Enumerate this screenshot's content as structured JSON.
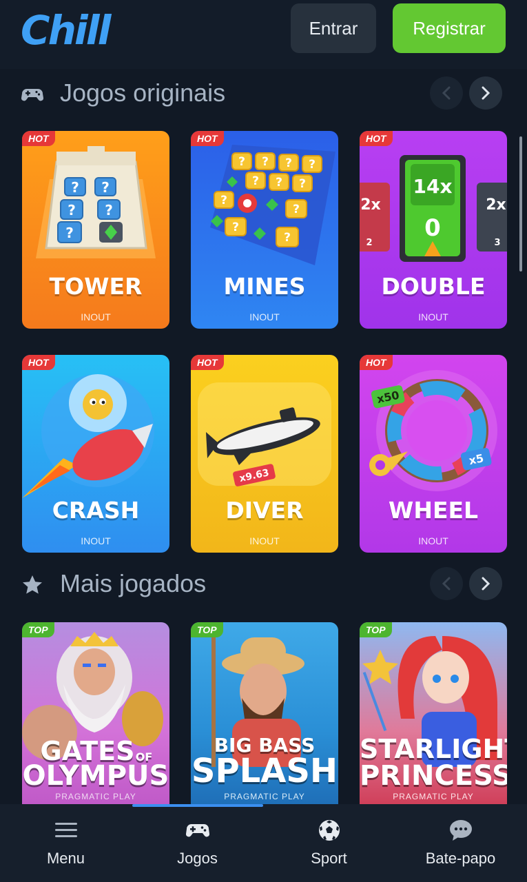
{
  "header": {
    "logo": "Chill",
    "login_label": "Entrar",
    "register_label": "Registrar"
  },
  "sections": {
    "originals": {
      "title": "Jogos originais",
      "icon": "gamepad-icon"
    },
    "most_played": {
      "title": "Mais jogados",
      "icon": "star-icon"
    }
  },
  "originals": [
    {
      "badge": "HOT",
      "title": "TOWER",
      "provider": "INOUT",
      "color": "#f58a1c"
    },
    {
      "badge": "HOT",
      "title": "MINES",
      "provider": "INOUT",
      "color": "#2f6df0"
    },
    {
      "badge": "HOT",
      "title": "DOUBLE",
      "provider": "INOUT",
      "color": "#b33ff0"
    },
    {
      "badge": "HOT",
      "title": "CRASH",
      "provider": "INOUT",
      "color": "#29a9f2"
    },
    {
      "badge": "HOT",
      "title": "DIVER",
      "provider": "INOUT",
      "color": "#f5c21c"
    },
    {
      "badge": "HOT",
      "title": "WHEEL",
      "provider": "INOUT",
      "color": "#c23fe6"
    }
  ],
  "art_text": {
    "double_multiplier": "14x",
    "double_value": "0",
    "double_left": "2x",
    "double_left_num": "2",
    "double_right": "2x",
    "double_right_num": "3",
    "diver_multiplier": "x9.63",
    "wheel_top": "x50",
    "wheel_bottom": "x5"
  },
  "most_played": [
    {
      "badge": "TOP",
      "title_line1": "GATES",
      "title_of": "OF",
      "title_line2": "OLYMPUS",
      "provider": "PRAGMATIC PLAY"
    },
    {
      "badge": "TOP",
      "title_line1": "BIG BASS",
      "title_line2": "SPLASH",
      "provider": "PRAGMATIC PLAY"
    },
    {
      "badge": "TOP",
      "title_line1": "STARLIGHT",
      "title_line2": "PRINCESS",
      "provider": "PRAGMATIC PLAY"
    }
  ],
  "bottom_nav": [
    {
      "label": "Menu",
      "icon": "hamburger-icon"
    },
    {
      "label": "Jogos",
      "icon": "gamepad-icon",
      "active": true
    },
    {
      "label": "Sport",
      "icon": "soccer-ball-icon"
    },
    {
      "label": "Bate-papo",
      "icon": "chat-bubble-icon"
    }
  ]
}
